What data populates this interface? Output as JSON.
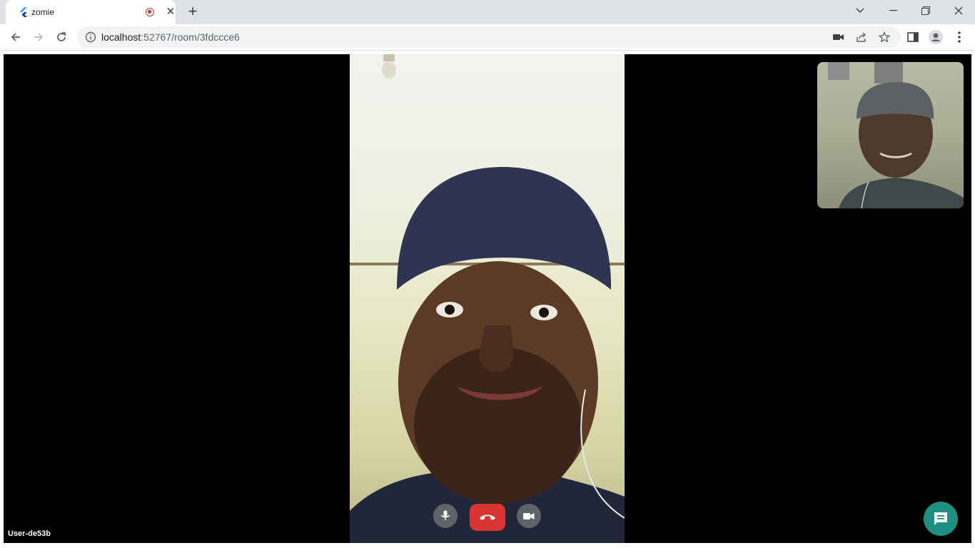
{
  "browser": {
    "tab": {
      "title": "zomie",
      "favicon": "flutter-icon",
      "recording_indicator": "record-icon",
      "close_icon": "close-icon"
    },
    "new_tab_icon": "plus-icon",
    "window_controls": [
      "chevron-down-icon",
      "minimize-icon",
      "restore-icon",
      "close-icon"
    ],
    "nav": {
      "back_icon": "arrow-left-icon",
      "forward_icon": "arrow-right-icon",
      "reload_icon": "reload-icon"
    },
    "address_bar": {
      "host": "localhost",
      "rest": ":52767/room/3fdccce6",
      "info_icon": "info-icon"
    },
    "toolbar_icons": [
      "camera-icon",
      "share-icon",
      "star-icon",
      "side-panel-icon",
      "profile-icon",
      "kebab-menu-icon"
    ]
  },
  "call": {
    "participant_label": "User-de53b",
    "controls": {
      "mic_icon": "microphone-icon",
      "end_icon": "phone-hangup-icon",
      "camera_icon": "video-camera-icon"
    },
    "chat_icon": "chat-icon"
  },
  "colors": {
    "end_call": "#d93434",
    "chat_fab": "#1e8f80",
    "control_bg": "#5f6368",
    "stage_bg": "#000000"
  }
}
